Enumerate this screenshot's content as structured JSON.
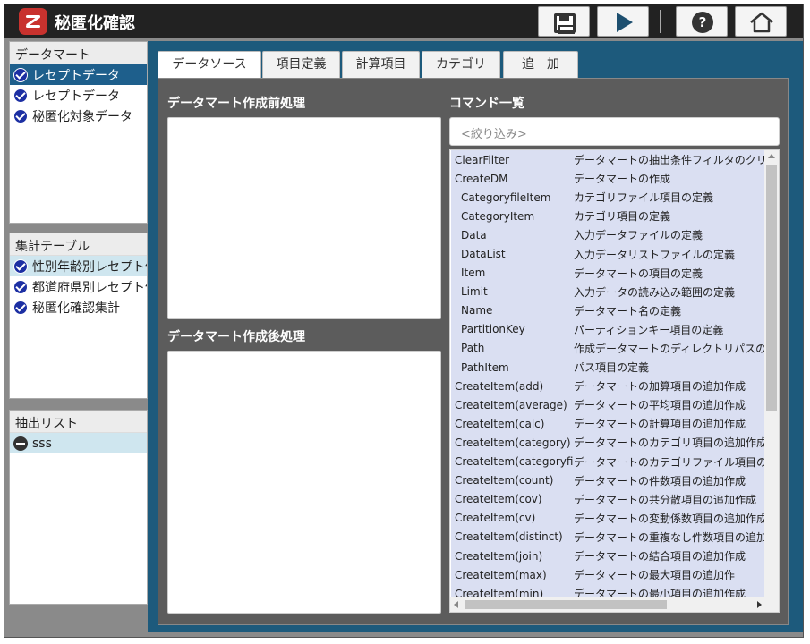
{
  "app": {
    "title": "秘匿化確認"
  },
  "toolbar": {
    "save_icon": "save-icon",
    "run_icon": "play-icon",
    "help_label": "?",
    "home_icon": "home-icon"
  },
  "panels": {
    "datamart": {
      "title": "データマート",
      "items": [
        {
          "label": "レセプトデータ",
          "icon": "check-circle-icon",
          "state": "selected"
        },
        {
          "label": "レセプトデータ",
          "icon": "check-circle-icon",
          "state": "normal"
        },
        {
          "label": "秘匿化対象データ",
          "icon": "check-circle-icon",
          "state": "normal"
        }
      ]
    },
    "aggregate": {
      "title": "集計テーブル",
      "items": [
        {
          "label": "性別年齢別レセプト件",
          "icon": "check-circle-icon",
          "state": "highlight"
        },
        {
          "label": "都道府県別レセプト件",
          "icon": "check-circle-icon",
          "state": "normal"
        },
        {
          "label": "秘匿化確認集計",
          "icon": "check-circle-icon",
          "state": "normal"
        }
      ]
    },
    "extract": {
      "title": "抽出リスト",
      "items": [
        {
          "label": "sss",
          "icon": "minus-circle-icon",
          "state": "highlight"
        }
      ]
    }
  },
  "tabs": [
    {
      "label": "データソース",
      "active": true
    },
    {
      "label": "項目定義",
      "active": false
    },
    {
      "label": "計算項目",
      "active": false
    },
    {
      "label": "カテゴリ",
      "active": false
    },
    {
      "label": "追　加",
      "active": false
    }
  ],
  "editor": {
    "pre_title": "データマート作成前処理",
    "pre_value": "",
    "post_title": "データマート作成後処理",
    "post_value": ""
  },
  "commands": {
    "title": "コマンド一覧",
    "filter_placeholder": "<絞り込み>",
    "rows": [
      {
        "name": "ClearFilter",
        "desc": "データマートの抽出条件フィルタのクリ",
        "sub": false
      },
      {
        "name": "CreateDM",
        "desc": "データマートの作成",
        "sub": false
      },
      {
        "name": "CategoryfileItem",
        "desc": "カテゴリファイル項目の定義",
        "sub": true
      },
      {
        "name": "CategoryItem",
        "desc": "カテゴリ項目の定義",
        "sub": true
      },
      {
        "name": "Data",
        "desc": "入力データファイルの定義",
        "sub": true
      },
      {
        "name": "DataList",
        "desc": "入力データリストファイルの定義",
        "sub": true
      },
      {
        "name": "Item",
        "desc": "データマートの項目の定義",
        "sub": true
      },
      {
        "name": "Limit",
        "desc": "入力データの読み込み範囲の定義",
        "sub": true
      },
      {
        "name": "Name",
        "desc": "データマート名の定義",
        "sub": true
      },
      {
        "name": "PartitionKey",
        "desc": "パーティションキー項目の定義",
        "sub": true
      },
      {
        "name": "Path",
        "desc": "作成データマートのディレクトリパスの",
        "sub": true
      },
      {
        "name": "PathItem",
        "desc": "パス項目の定義",
        "sub": true
      },
      {
        "name": "CreateItem(add)",
        "desc": "データマートの加算項目の追加作成",
        "sub": false
      },
      {
        "name": "CreateItem(average)",
        "desc": "データマートの平均項目の追加作成",
        "sub": false
      },
      {
        "name": "CreateItem(calc)",
        "desc": "データマートの計算項目の追加作成",
        "sub": false
      },
      {
        "name": "CreateItem(category)",
        "desc": "データマートのカテゴリ項目の追加作成",
        "sub": false
      },
      {
        "name": "CreateItem(categoryfile)",
        "desc": "データマートのカテゴリファイル項目の",
        "sub": false
      },
      {
        "name": "CreateItem(count)",
        "desc": "データマートの件数項目の追加作成",
        "sub": false
      },
      {
        "name": "CreateItem(cov)",
        "desc": "データマートの共分散項目の追加作成",
        "sub": false
      },
      {
        "name": "CreateItem(cv)",
        "desc": "データマートの変動係数項目の追加作成",
        "sub": false
      },
      {
        "name": "CreateItem(distinct)",
        "desc": "データマートの重複なし件数項目の追加",
        "sub": false
      },
      {
        "name": "CreateItem(join)",
        "desc": "データマートの結合項目の追加作成",
        "sub": false
      },
      {
        "name": "CreateItem(max)",
        "desc": "データマートの最大項目の追加作",
        "sub": false
      },
      {
        "name": "CreateItem(min)",
        "desc": "データマートの最小項目の追加作成",
        "sub": false
      }
    ]
  },
  "colors": {
    "header_bg": "#222222",
    "main_bg": "#1d5a7c",
    "selected_bg": "#1e5f8c",
    "highlight_bg": "#cfe6ef",
    "cmdlist_bg": "#dadff2",
    "check_blue": "#1c2fa3",
    "logo_red": "#c8322e"
  }
}
